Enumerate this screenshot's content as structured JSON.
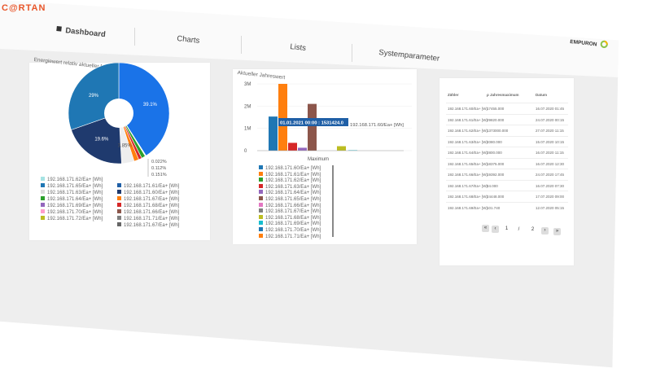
{
  "app": {
    "logo": "C@RTAN",
    "brand": "EMPURON"
  },
  "nav": {
    "items": [
      {
        "label": "Dashboard"
      },
      {
        "label": "Charts"
      },
      {
        "label": "Lists"
      },
      {
        "label": "Systemparameter"
      }
    ]
  },
  "pie_card": {
    "title": "Energiewert relativ aktueller Monat",
    "legend": [
      {
        "label": "192.168.171.62/Ea+ [Wh]",
        "color": "#a6e3e3"
      },
      {
        "label": "192.168.171.65/Ea+ [Wh]",
        "color": "#1f77b4"
      },
      {
        "label": "192.168.171.63/Ea+ [Wh]",
        "color": "#dddddd"
      },
      {
        "label": "192.168.171.64/Ea+ [Wh]",
        "color": "#2ca02c"
      },
      {
        "label": "192.168.171.69/Ea+ [Wh]",
        "color": "#9467bd"
      },
      {
        "label": "192.168.171.70/Ea+ [Wh]",
        "color": "#ff9ecb"
      },
      {
        "label": "192.168.171.72/Ea+ [Wh]",
        "color": "#bcbd22"
      },
      {
        "label": "192.168.171.61/Ea+ [Wh]",
        "color": "#1f5fa6"
      },
      {
        "label": "192.168.171.60/Ea+ [Wh]",
        "color": "#1f3a6e"
      },
      {
        "label": "192.168.171.67/Ea+ [Wh]",
        "color": "#ff7f0e"
      },
      {
        "label": "192.168.171.68/Ea+ [Wh]",
        "color": "#d62728"
      },
      {
        "label": "192.168.171.66/Ea+ [Wh]",
        "color": "#8c564b"
      },
      {
        "label": "192.168.171.71/Ea+ [Wh]",
        "color": "#7f7f7f"
      },
      {
        "label": "192.168.171.67/Ea+ [Wh]",
        "color": "#666666"
      }
    ]
  },
  "bar_card": {
    "title": "Aktueller Jahreswert",
    "tooltip": "01.01.2021 00:00 : 1531424.0",
    "tooltip_series": "192.168.171.60/Ea+ [Wh]",
    "axis_label": "Maximum",
    "legend": [
      {
        "label": "192.168.171.60/Ea+ [Wh]",
        "color": "#1f77b4"
      },
      {
        "label": "192.168.171.61/Ea+ [Wh]",
        "color": "#ff7f0e"
      },
      {
        "label": "192.168.171.62/Ea+ [Wh]",
        "color": "#2ca02c"
      },
      {
        "label": "192.168.171.63/Ea+ [Wh]",
        "color": "#d62728"
      },
      {
        "label": "192.168.171.64/Ea+ [Wh]",
        "color": "#9467bd"
      },
      {
        "label": "192.168.171.65/Ea+ [Wh]",
        "color": "#8c564b"
      },
      {
        "label": "192.168.171.66/Ea+ [Wh]",
        "color": "#e377c2"
      },
      {
        "label": "192.168.171.67/Ea+ [Wh]",
        "color": "#7f7f7f"
      },
      {
        "label": "192.168.171.68/Ea+ [Wh]",
        "color": "#bcbd22"
      },
      {
        "label": "192.168.171.69/Ea+ [Wh]",
        "color": "#17becf"
      },
      {
        "label": "192.168.171.70/Ea+ [Wh]",
        "color": "#1f77b4"
      },
      {
        "label": "192.168.171.71/Ea+ [Wh]",
        "color": "#ff7f0e"
      }
    ]
  },
  "table_card": {
    "headers": [
      "Zähler",
      "ρ Jahresmaximum",
      "Datum"
    ],
    "rows": [
      [
        "192.168.171.60/Ea+ [W]",
        "17455.000",
        "16.07.2020 01:45"
      ],
      [
        "192.168.171.61/Ea+ [W]",
        "29820.000",
        "24.07.2020 00:15"
      ],
      [
        "192.168.171.62/Ea+ [W]",
        "1373000.000",
        "27.07.2020 11:15"
      ],
      [
        "192.168.171.63/Ea+ [W]",
        "4080.000",
        "15.07.2020 10:15"
      ],
      [
        "192.168.171.64/Ea+ [W]",
        "2800.000",
        "16.07.2020 11:15"
      ],
      [
        "192.168.171.65/Ea+ [W]",
        "18375.000",
        "16.07.2020 12:30"
      ],
      [
        "192.168.171.66/Ea+ [W]",
        "19392.000",
        "24.07.2020 17:45"
      ],
      [
        "192.168.171.67/Ea+ [W]",
        "84.000",
        "16.07.2020 07:30"
      ],
      [
        "192.168.171.68/Ea+ [W]",
        "24448.000",
        "17.07.2020 09:00"
      ],
      [
        "192.168.171.69/Ea+ [W]",
        "101.740",
        "12.07.2020 05:15"
      ]
    ],
    "pagination": [
      "«",
      "‹",
      "1",
      "/",
      "2",
      "›",
      "»"
    ]
  },
  "chart_data": [
    {
      "type": "pie",
      "title": "Energiewert relativ aktueller Monat",
      "slices": [
        {
          "label": "192.168.171.61/Ea+ [Wh]",
          "value": 39.1,
          "color": "#1a73e8"
        },
        {
          "label": "192.168.171.62/Ea+ [Wh]",
          "value": 0.022,
          "color": "#a6e3e3"
        },
        {
          "label": "192.168.171.70/Ea+ [Wh]",
          "value": 0.112,
          "color": "#ff9ecb"
        },
        {
          "label": "192.168.171.72/Ea+ [Wh]",
          "value": 0.151,
          "color": "#bcbd22"
        },
        {
          "label": "192.168.171.64/Ea+ [Wh]",
          "value": 1.2,
          "color": "#2ca02c"
        },
        {
          "label": "192.168.171.68/Ea+ [Wh]",
          "value": 1.0,
          "color": "#d62728"
        },
        {
          "label": "192.168.171.67/Ea+ [Wh]",
          "value": 1.5,
          "color": "#ff7f0e"
        },
        {
          "label": "192.168.171.63/Ea+ [Wh]",
          "value": 3.85,
          "color": "#eeeeee"
        },
        {
          "label": "192.168.171.60/Ea+ [Wh]",
          "value": 19.6,
          "color": "#1f3a6e"
        },
        {
          "label": "192.168.171.65/Ea+ [Wh]",
          "value": 29.0,
          "color": "#1f77b4"
        }
      ],
      "labels_shown": [
        "39.1%",
        "29%",
        "19.6%",
        "3.85%",
        "0.022%",
        "0.112%",
        "0.151%"
      ]
    },
    {
      "type": "bar",
      "title": "Aktueller Jahreswert",
      "yticks": [
        "3M",
        "2M",
        "1M",
        "0"
      ],
      "ylim": [
        0,
        3000000
      ],
      "categories": [
        "Maximum"
      ],
      "series": [
        {
          "name": "192.168.171.60/Ea+ [Wh]",
          "values": [
            1531424
          ],
          "color": "#1f77b4"
        },
        {
          "name": "192.168.171.61/Ea+ [Wh]",
          "values": [
            3000000
          ],
          "color": "#ff7f0e"
        },
        {
          "name": "192.168.171.63/Ea+ [Wh]",
          "values": [
            350000
          ],
          "color": "#d62728"
        },
        {
          "name": "192.168.171.64/Ea+ [Wh]",
          "values": [
            130000
          ],
          "color": "#9467bd"
        },
        {
          "name": "192.168.171.65/Ea+ [Wh]",
          "values": [
            2100000
          ],
          "color": "#8c564b"
        },
        {
          "name": "192.168.171.68/Ea+ [Wh]",
          "values": [
            200000
          ],
          "color": "#bcbd22"
        },
        {
          "name": "192.168.171.69/Ea+ [Wh]",
          "values": [
            20000
          ],
          "color": "#17becf"
        }
      ]
    }
  ]
}
